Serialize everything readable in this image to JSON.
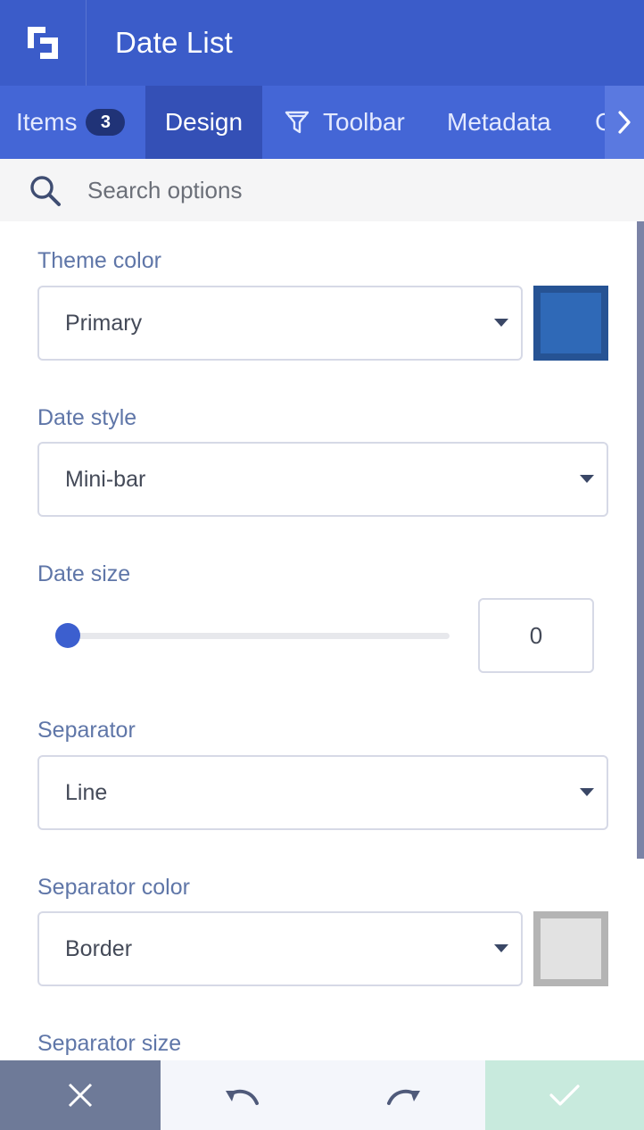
{
  "header": {
    "title": "Date List",
    "logo_icon": "logo-icon"
  },
  "tabs": [
    {
      "label": "Items",
      "badge": "3"
    },
    {
      "label": "Design"
    },
    {
      "label": "Toolbar",
      "icon": "filter-icon"
    },
    {
      "label": "Metadata"
    },
    {
      "label": "C"
    }
  ],
  "search": {
    "placeholder": "Search options"
  },
  "fields": {
    "theme_color": {
      "label": "Theme color",
      "value": "Primary",
      "swatch_color": "#2f69b7",
      "swatch_border": "#265394"
    },
    "date_style": {
      "label": "Date style",
      "value": "Mini-bar"
    },
    "date_size": {
      "label": "Date size",
      "value": "0"
    },
    "separator": {
      "label": "Separator",
      "value": "Line"
    },
    "separator_color": {
      "label": "Separator color",
      "value": "Border",
      "swatch_color": "#e2e2e2",
      "swatch_border": "#b4b4b4"
    },
    "separator_size": {
      "label": "Separator size"
    }
  },
  "colors": {
    "accent": "#3b5cc9",
    "tab_bar": "#4466d6",
    "active_tab": "#3450b6",
    "label": "#5f76a8",
    "confirm": "#c8eadd"
  }
}
